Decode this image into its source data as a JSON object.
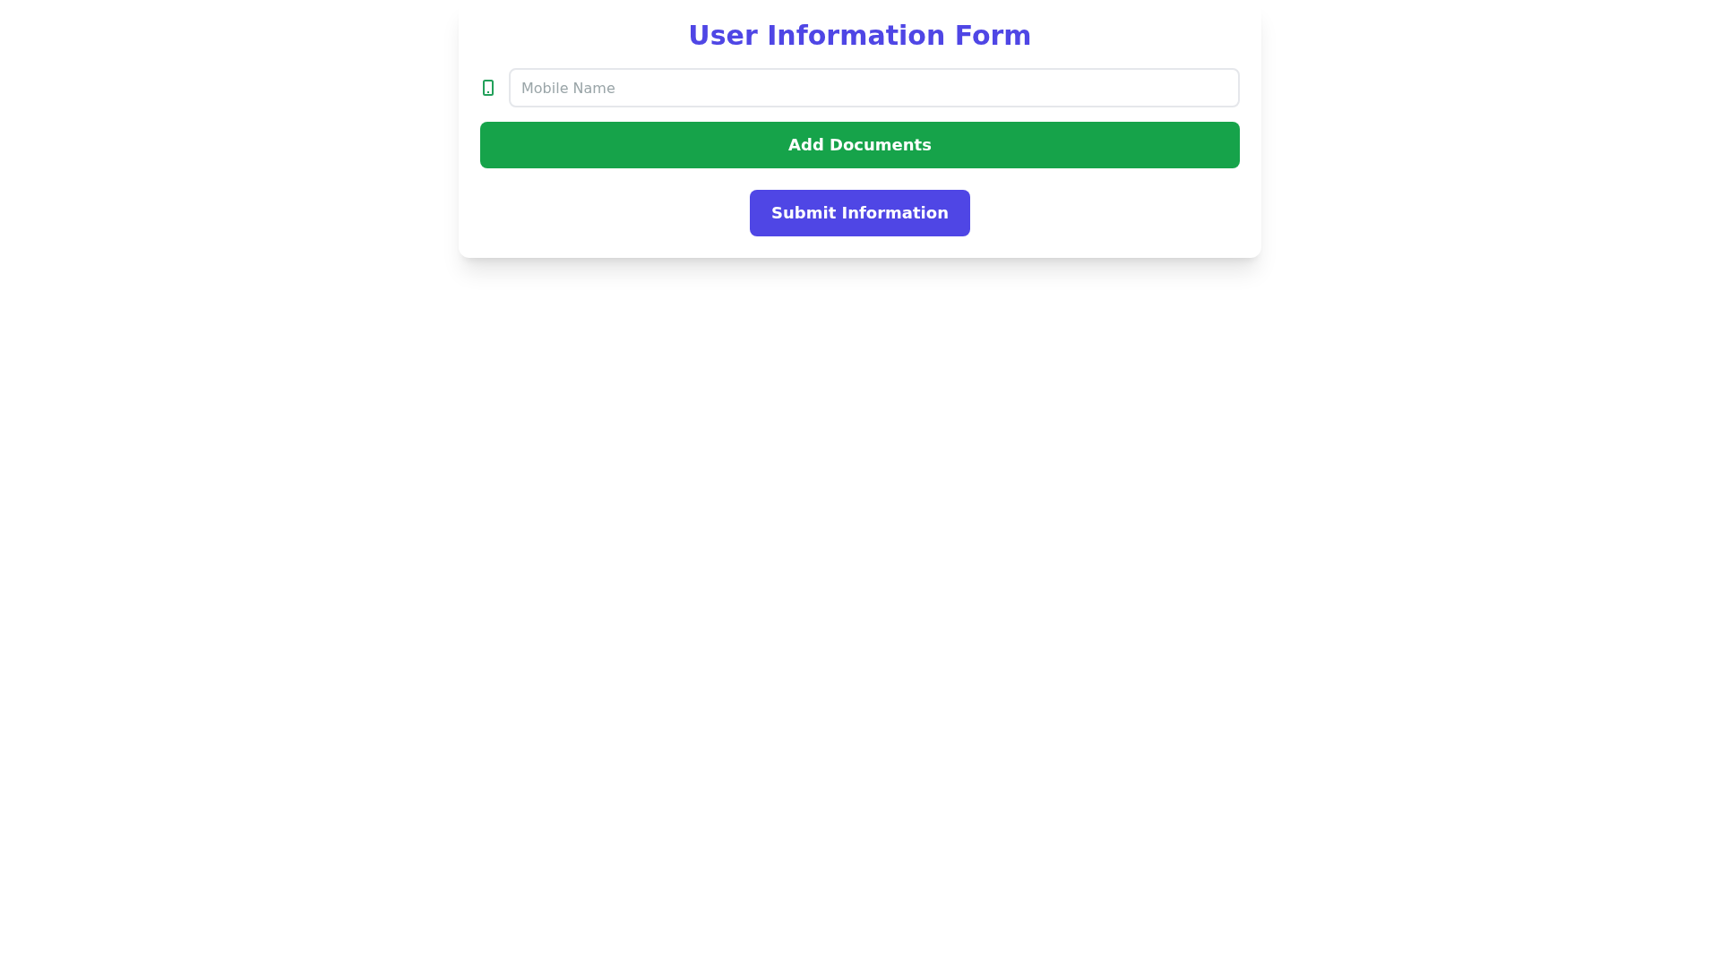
{
  "form": {
    "title": "User Information Form",
    "field": {
      "placeholder": "Mobile Name"
    },
    "buttons": [
      {
        "label": "Add Documents",
        "kind": "secondary"
      },
      {
        "label": "Submit Information",
        "kind": "primary"
      }
    ]
  }
}
